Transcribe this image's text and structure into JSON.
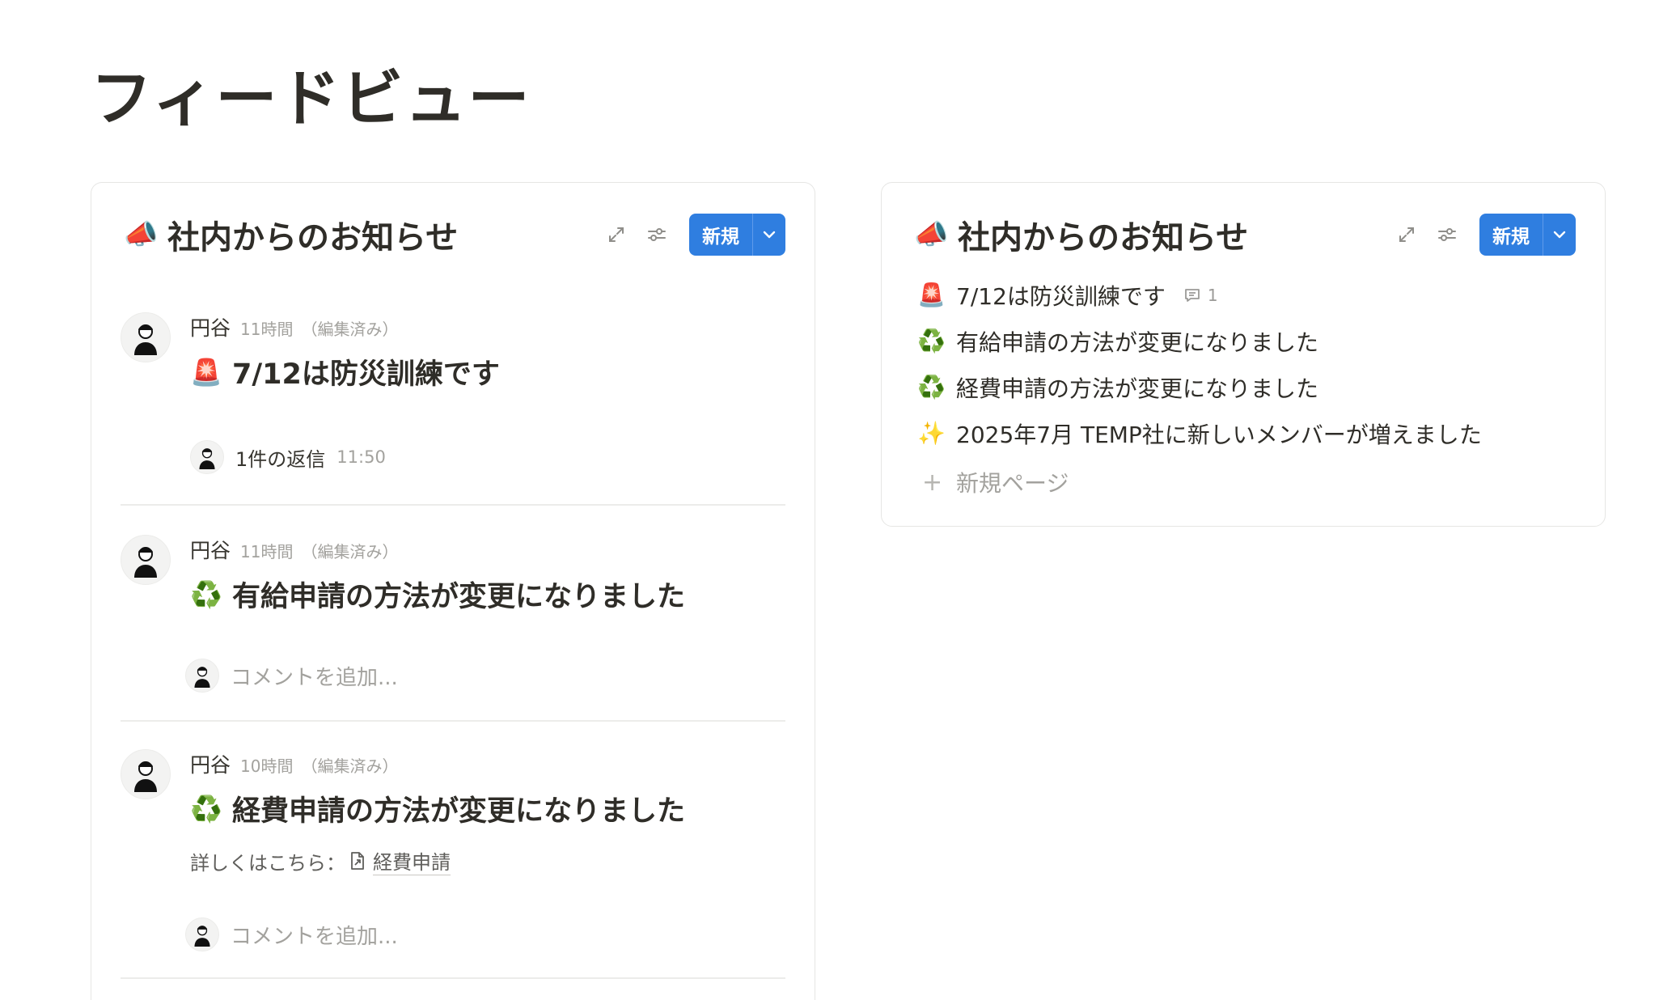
{
  "page": {
    "title": "フィードビュー"
  },
  "icons": {
    "megaphone": "📣",
    "siren": "🚨",
    "recycle": "♻️",
    "sparkles": "✨"
  },
  "colors": {
    "accent": "#2f7ee0",
    "muted": "#a3a29e",
    "border": "#e6e6e4"
  },
  "left_panel": {
    "title": "社内からのお知らせ",
    "new_label": "新規",
    "items": [
      {
        "author": "円谷",
        "time": "11時間",
        "edited": "（編集済み）",
        "title": "7/12は防災訓練です",
        "reply_text": "1件の返信",
        "reply_time": "11:50"
      },
      {
        "author": "円谷",
        "time": "11時間",
        "edited": "（編集済み）",
        "title": "有給申請の方法が変更になりました",
        "comment_placeholder": "コメントを追加..."
      },
      {
        "author": "円谷",
        "time": "10時間",
        "edited": "（編集済み）",
        "title": "経費申請の方法が変更になりました",
        "detail_prefix": "詳しくはこちら：",
        "detail_link": "経費申請",
        "comment_placeholder": "コメントを追加..."
      }
    ]
  },
  "right_panel": {
    "title": "社内からのお知らせ",
    "new_label": "新規",
    "items": [
      {
        "title": "7/12は防災訓練です",
        "comment_count": "1"
      },
      {
        "title": "有給申請の方法が変更になりました"
      },
      {
        "title": "経費申請の方法が変更になりました"
      },
      {
        "title": "2025年7月 TEMP社に新しいメンバーが増えました"
      }
    ],
    "new_page_label": "新規ページ"
  }
}
